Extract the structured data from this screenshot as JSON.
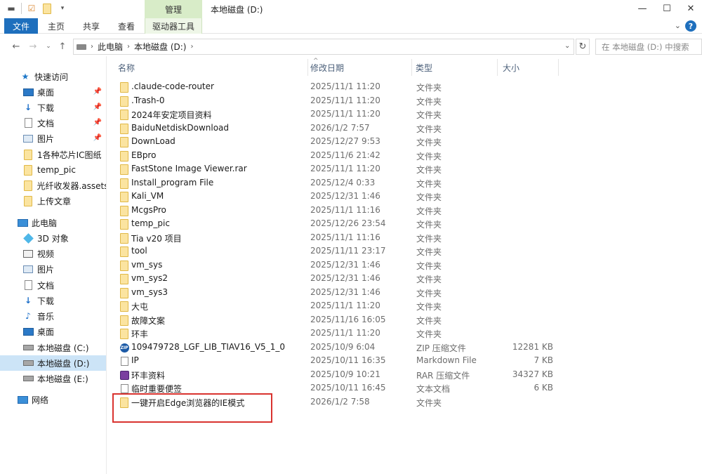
{
  "window": {
    "title": "本地磁盘 (D:)",
    "context_tab_group": "管理"
  },
  "ribbon": {
    "tabs": [
      "文件",
      "主页",
      "共享",
      "查看",
      "驱动器工具"
    ]
  },
  "address": {
    "crumbs": [
      "此电脑",
      "本地磁盘 (D:)"
    ],
    "search_placeholder": "在 本地磁盘 (D:) 中搜索"
  },
  "sidebar": {
    "quick_access": "快速访问",
    "quick_items": [
      {
        "label": "桌面",
        "icon": "desktop-icon",
        "pinned": true
      },
      {
        "label": "下载",
        "icon": "download-icon",
        "pinned": true
      },
      {
        "label": "文档",
        "icon": "document-icon",
        "pinned": true
      },
      {
        "label": "图片",
        "icon": "picture-icon",
        "pinned": true
      },
      {
        "label": "1各种芯片IC图纸",
        "icon": "folder-icon",
        "pinned": false
      },
      {
        "label": "temp_pic",
        "icon": "folder-icon",
        "pinned": false
      },
      {
        "label": "光纤收发器.assets",
        "icon": "folder-icon",
        "pinned": false
      },
      {
        "label": "上传文章",
        "icon": "folder-icon",
        "pinned": false
      }
    ],
    "this_pc": "此电脑",
    "pc_items": [
      {
        "label": "3D 对象",
        "icon": "3d-objects-icon"
      },
      {
        "label": "视频",
        "icon": "video-icon"
      },
      {
        "label": "图片",
        "icon": "picture-icon"
      },
      {
        "label": "文档",
        "icon": "document-icon"
      },
      {
        "label": "下载",
        "icon": "download-icon"
      },
      {
        "label": "音乐",
        "icon": "music-icon"
      },
      {
        "label": "桌面",
        "icon": "desktop-icon"
      },
      {
        "label": "本地磁盘 (C:)",
        "icon": "drive-icon"
      },
      {
        "label": "本地磁盘 (D:)",
        "icon": "drive-icon",
        "selected": true
      },
      {
        "label": "本地磁盘 (E:)",
        "icon": "drive-icon"
      }
    ],
    "network": "网络"
  },
  "columns": {
    "name": "名称",
    "date": "修改日期",
    "type": "类型",
    "size": "大小"
  },
  "files": [
    {
      "name": ".claude-code-router",
      "date": "2025/11/1 11:20",
      "type": "文件夹",
      "size": "",
      "icon": "folder"
    },
    {
      "name": ".Trash-0",
      "date": "2025/11/1 11:20",
      "type": "文件夹",
      "size": "",
      "icon": "folder"
    },
    {
      "name": "2024年安定项目资料",
      "date": "2025/11/1 11:20",
      "type": "文件夹",
      "size": "",
      "icon": "folder"
    },
    {
      "name": "BaiduNetdiskDownload",
      "date": "2026/1/2 7:57",
      "type": "文件夹",
      "size": "",
      "icon": "folder"
    },
    {
      "name": "DownLoad",
      "date": "2025/12/27 9:53",
      "type": "文件夹",
      "size": "",
      "icon": "folder"
    },
    {
      "name": "EBpro",
      "date": "2025/11/6 21:42",
      "type": "文件夹",
      "size": "",
      "icon": "folder"
    },
    {
      "name": "FastStone Image Viewer.rar",
      "date": "2025/11/1 11:20",
      "type": "文件夹",
      "size": "",
      "icon": "folder"
    },
    {
      "name": "Install_program File",
      "date": "2025/12/4 0:33",
      "type": "文件夹",
      "size": "",
      "icon": "folder"
    },
    {
      "name": "Kali_VM",
      "date": "2025/12/31 1:46",
      "type": "文件夹",
      "size": "",
      "icon": "folder"
    },
    {
      "name": "McgsPro",
      "date": "2025/11/1 11:16",
      "type": "文件夹",
      "size": "",
      "icon": "folder"
    },
    {
      "name": "temp_pic",
      "date": "2025/12/26 23:54",
      "type": "文件夹",
      "size": "",
      "icon": "folder"
    },
    {
      "name": "Tia v20 项目",
      "date": "2025/11/1 11:16",
      "type": "文件夹",
      "size": "",
      "icon": "folder"
    },
    {
      "name": "tool",
      "date": "2025/11/11 23:17",
      "type": "文件夹",
      "size": "",
      "icon": "folder"
    },
    {
      "name": "vm_sys",
      "date": "2025/12/31 1:46",
      "type": "文件夹",
      "size": "",
      "icon": "folder"
    },
    {
      "name": "vm_sys2",
      "date": "2025/12/31 1:46",
      "type": "文件夹",
      "size": "",
      "icon": "folder"
    },
    {
      "name": "vm_sys3",
      "date": "2025/12/31 1:46",
      "type": "文件夹",
      "size": "",
      "icon": "folder"
    },
    {
      "name": "大屯",
      "date": "2025/11/1 11:20",
      "type": "文件夹",
      "size": "",
      "icon": "folder"
    },
    {
      "name": "故障文案",
      "date": "2025/11/16 16:05",
      "type": "文件夹",
      "size": "",
      "icon": "folder"
    },
    {
      "name": "环丰",
      "date": "2025/11/1 11:20",
      "type": "文件夹",
      "size": "",
      "icon": "folder"
    },
    {
      "name": "109479728_LGF_LIB_TIAV16_V5_1_0",
      "date": "2025/10/9 6:04",
      "type": "ZIP 压缩文件",
      "size": "12281 KB",
      "icon": "zip"
    },
    {
      "name": "IP",
      "date": "2025/10/11 16:35",
      "type": "Markdown File",
      "size": "7 KB",
      "icon": "md"
    },
    {
      "name": "环丰资料",
      "date": "2025/10/9 10:21",
      "type": "RAR 压缩文件",
      "size": "34327 KB",
      "icon": "rar"
    },
    {
      "name": "临时重要便签",
      "date": "2025/10/11 16:45",
      "type": "文本文档",
      "size": "6 KB",
      "icon": "txt"
    },
    {
      "name": "一键开启Edge浏览器的IE模式",
      "date": "2026/1/2 7:58",
      "type": "文件夹",
      "size": "",
      "icon": "folder"
    }
  ]
}
